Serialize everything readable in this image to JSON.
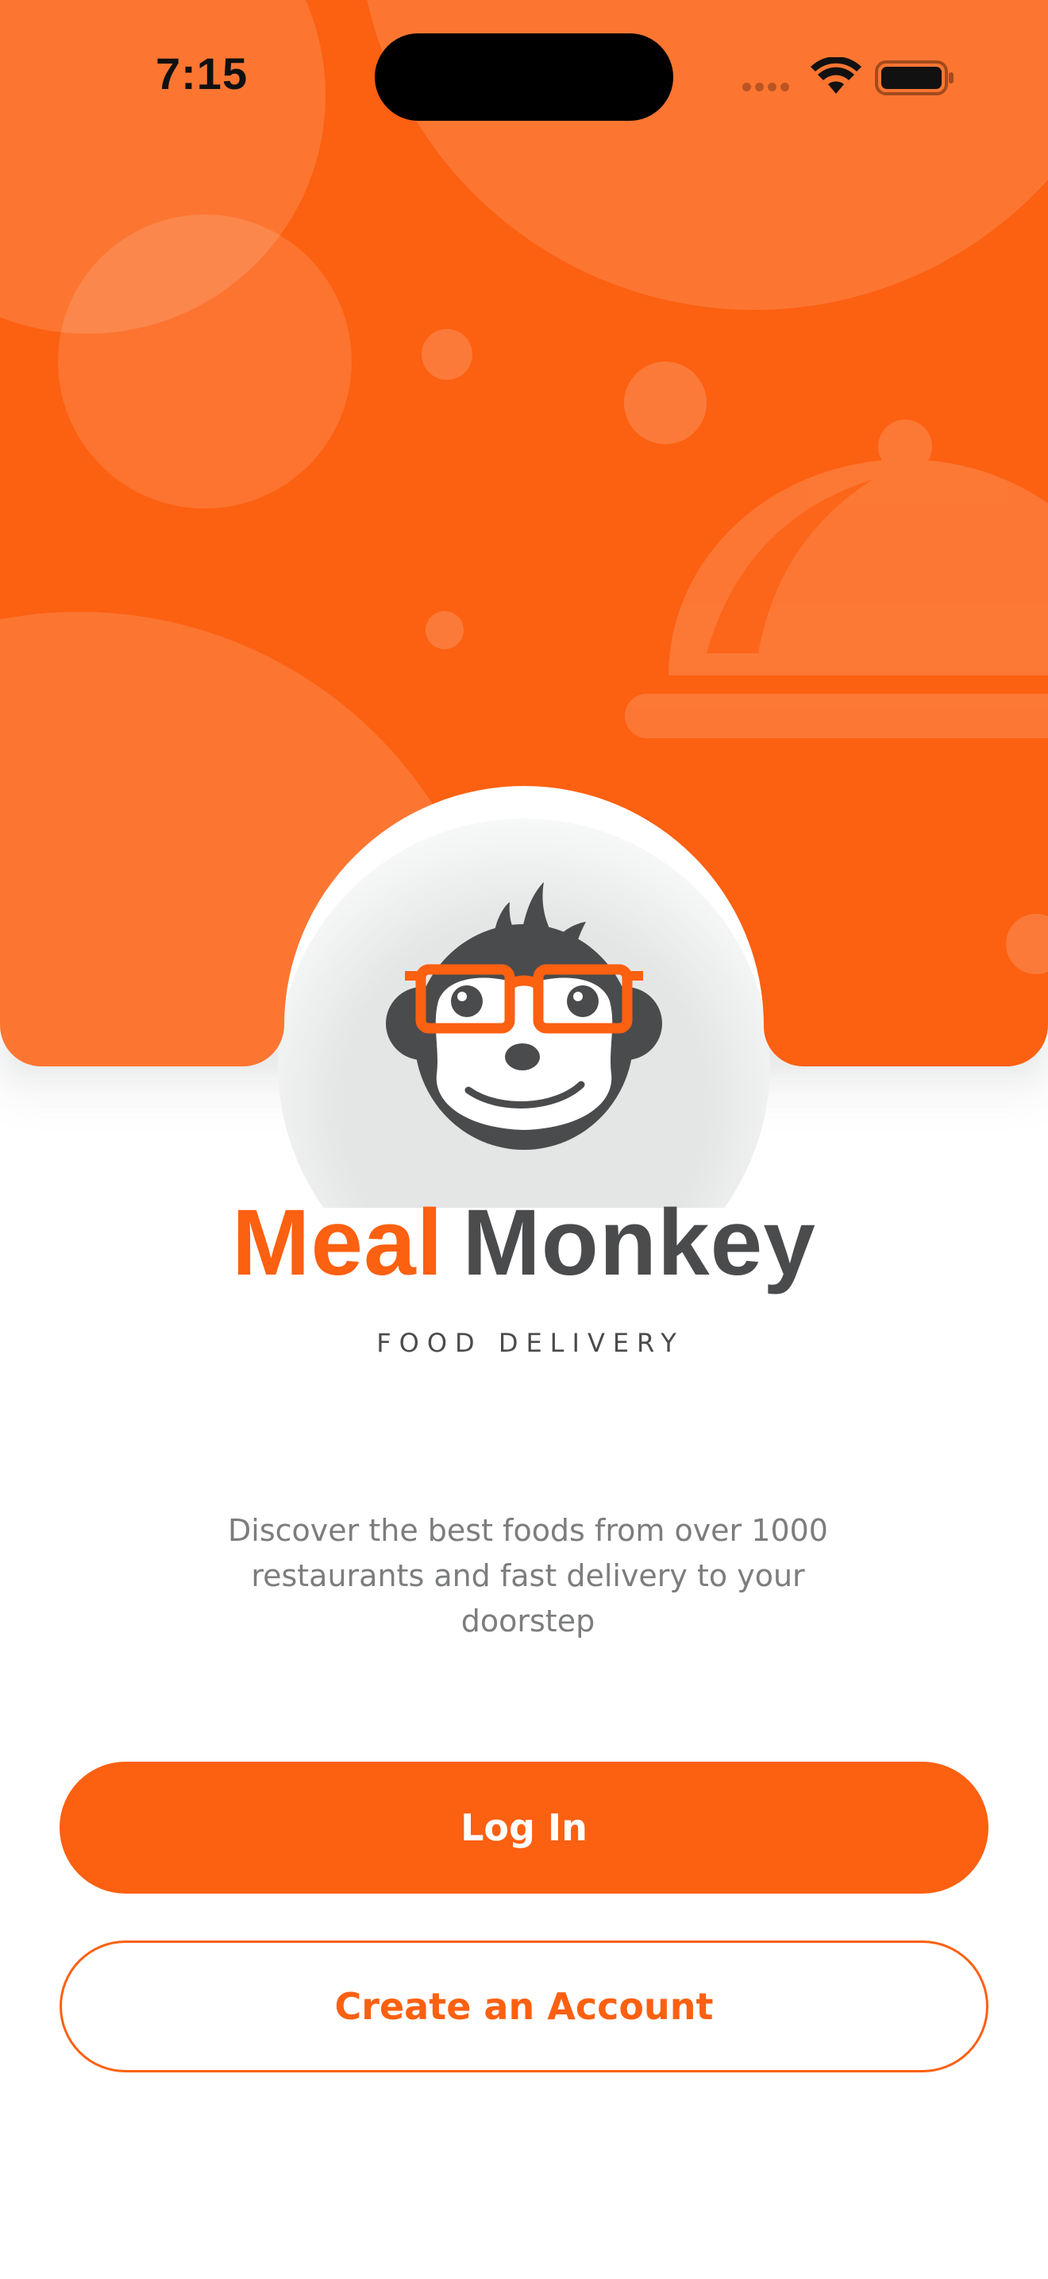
{
  "status_bar": {
    "time": "7:15"
  },
  "brand": {
    "name_part1": "Meal",
    "name_part2": "Monkey",
    "tagline": "FOOD DELIVERY"
  },
  "description": "Discover the best foods from over 1000 restaurants and fast delivery to your doorstep",
  "actions": {
    "login_label": "Log In",
    "create_account_label": "Create an Account"
  },
  "icons": {
    "hero": "serving-cloche-icon",
    "logo": "monkey-with-glasses-icon",
    "status": [
      "cellular-signal-icon",
      "wifi-icon",
      "battery-icon"
    ]
  },
  "colors": {
    "primary": "#fc6011",
    "primary_light": "#ff7f3c",
    "text_dark": "#4a4b4d",
    "text_muted": "#7c7d7e",
    "background": "#ffffff"
  }
}
